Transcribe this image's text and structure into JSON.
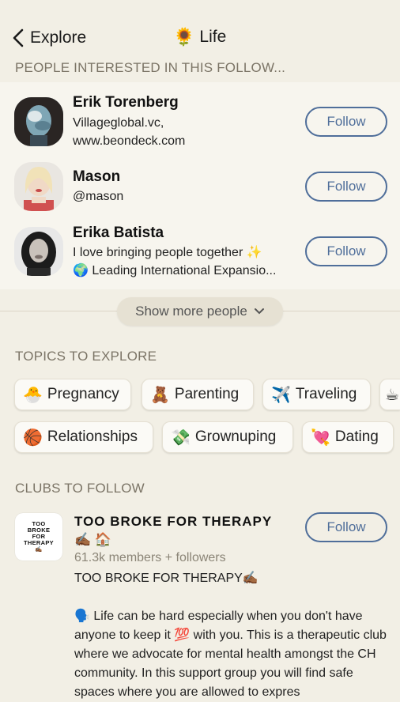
{
  "header": {
    "back_label": "Explore",
    "title_emoji": "🌻",
    "title": "Life"
  },
  "people_section": {
    "heading": "PEOPLE INTERESTED IN THIS FOLLOW...",
    "follow_label": "Follow",
    "people": [
      {
        "name": "Erik Torenberg",
        "bio_line1": "Villageglobal.vc,",
        "bio_line2": "www.beondeck.com"
      },
      {
        "name": "Mason",
        "bio_line1": "@mason",
        "bio_line2": ""
      },
      {
        "name": "Erika Batista",
        "bio_line1": "I love bringing people together ✨",
        "bio_line2": "🌍 Leading International Expansio..."
      }
    ],
    "show_more_label": "Show more people"
  },
  "topics_section": {
    "heading": "TOPICS TO EXPLORE",
    "row1": [
      {
        "emoji": "🐣",
        "label": "Pregnancy"
      },
      {
        "emoji": "🧸",
        "label": "Parenting"
      },
      {
        "emoji": "✈️",
        "label": "Traveling"
      },
      {
        "emoji": "☕",
        "label": ""
      }
    ],
    "row2": [
      {
        "emoji": "🏀",
        "label": "Relationships"
      },
      {
        "emoji": "💸",
        "label": "Grownuping"
      },
      {
        "emoji": "💘",
        "label": "Dating"
      }
    ]
  },
  "clubs_section": {
    "heading": "CLUBS TO FOLLOW",
    "club": {
      "logo_lines": [
        "TOO",
        "BROKE",
        "FOR",
        "THERAPY",
        "✍🏾"
      ],
      "name": "TOO BROKE FOR THERAPY",
      "badges": "✍🏾 🏠",
      "meta": "61.3k members + followers",
      "desc_line1": "TOO BROKE FOR THERAPY✍🏾",
      "desc_para": "🗣️ Life can be hard especially when you don't have anyone to keep it 💯 with you. This is a therapeutic club where we advocate for mental health amongst the CH community. In this support group you will find safe spaces where you are allowed to expres",
      "follow_label": "Follow"
    }
  }
}
